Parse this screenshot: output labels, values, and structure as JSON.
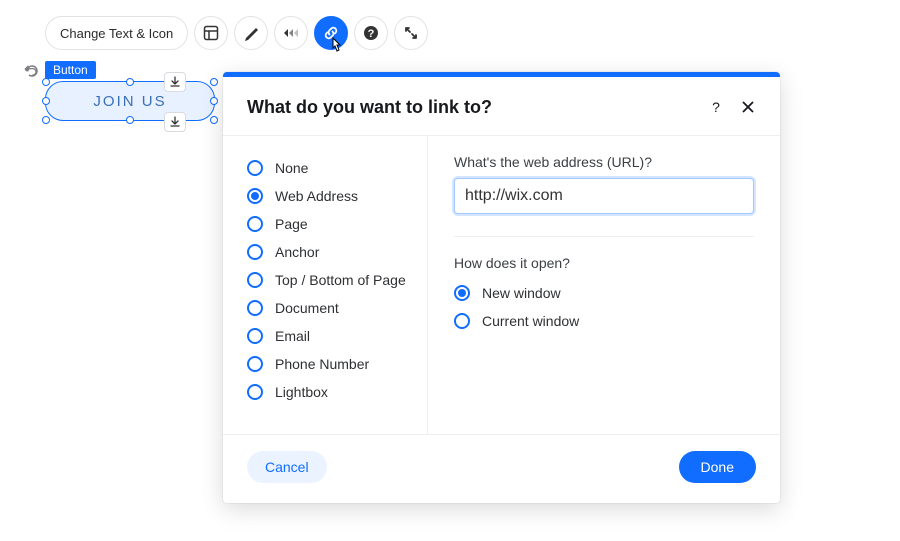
{
  "toolbar": {
    "change_text_label": "Change Text & Icon"
  },
  "selected_element": {
    "tag": "Button",
    "text": "JOIN US"
  },
  "dialog": {
    "title": "What do you want to link to?",
    "link_types": [
      {
        "label": "None"
      },
      {
        "label": "Web Address"
      },
      {
        "label": "Page"
      },
      {
        "label": "Anchor"
      },
      {
        "label": "Top / Bottom of Page"
      },
      {
        "label": "Document"
      },
      {
        "label": "Email"
      },
      {
        "label": "Phone Number"
      },
      {
        "label": "Lightbox"
      }
    ],
    "link_type_selected": 1,
    "url_section": {
      "label": "What's the web address (URL)?",
      "value": "http://wix.com"
    },
    "open_section": {
      "label": "How does it open?",
      "options": [
        {
          "label": "New window"
        },
        {
          "label": "Current window"
        }
      ],
      "selected": 0
    },
    "cancel_label": "Cancel",
    "done_label": "Done"
  }
}
